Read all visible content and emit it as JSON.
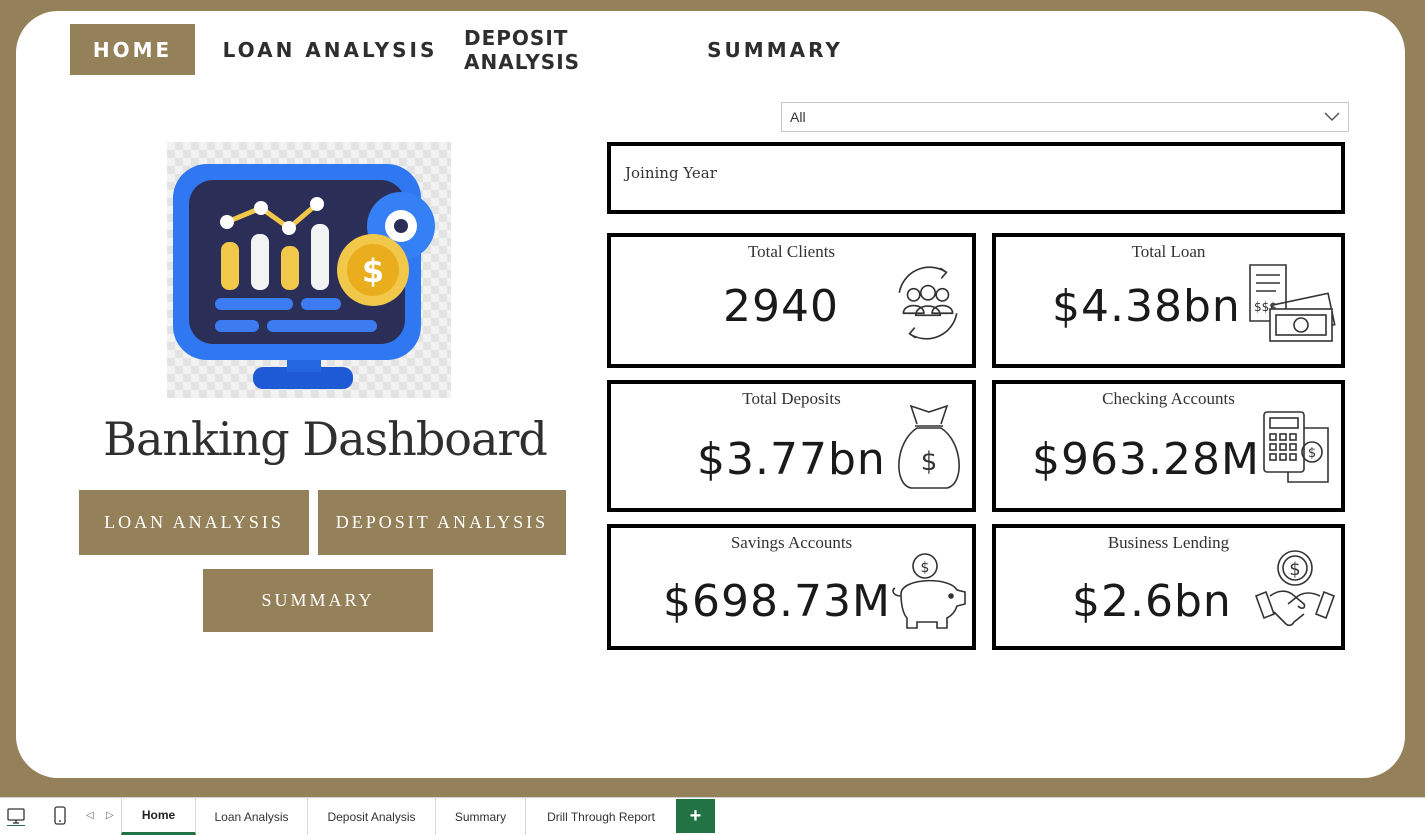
{
  "nav": {
    "home": "HOME",
    "loan_analysis": "LOAN ANALYSIS",
    "deposit_analysis": "DEPOSIT ANALYSIS",
    "summary": "SUMMARY"
  },
  "slicer": {
    "value": "All",
    "title": "Joining Year"
  },
  "dashboard": {
    "title": "Banking Dashboard",
    "buttons": {
      "loan": "LOAN ANALYSIS",
      "deposit": "DEPOSIT ANALYSIS",
      "summary": "SUMMARY"
    }
  },
  "cards": [
    {
      "label": "Total Clients",
      "value": "2940",
      "icon": "clients-cycle-icon"
    },
    {
      "label": "Total Loan",
      "value": "$4.38bn",
      "icon": "receipt-cash-icon"
    },
    {
      "label": "Total Deposits",
      "value": "$3.77bn",
      "icon": "money-bag-icon"
    },
    {
      "label": "Checking Accounts",
      "value": "$963.28M",
      "icon": "calculator-icon"
    },
    {
      "label": "Savings Accounts",
      "value": "$698.73M",
      "icon": "piggy-bank-icon"
    },
    {
      "label": "Business Lending",
      "value": "$2.6bn",
      "icon": "handshake-icon"
    }
  ],
  "tabs": [
    "Home",
    "Loan Analysis",
    "Deposit Analysis",
    "Summary",
    "Drill Through Report"
  ],
  "colors": {
    "accent": "#94815a",
    "tab_green": "#217346"
  }
}
